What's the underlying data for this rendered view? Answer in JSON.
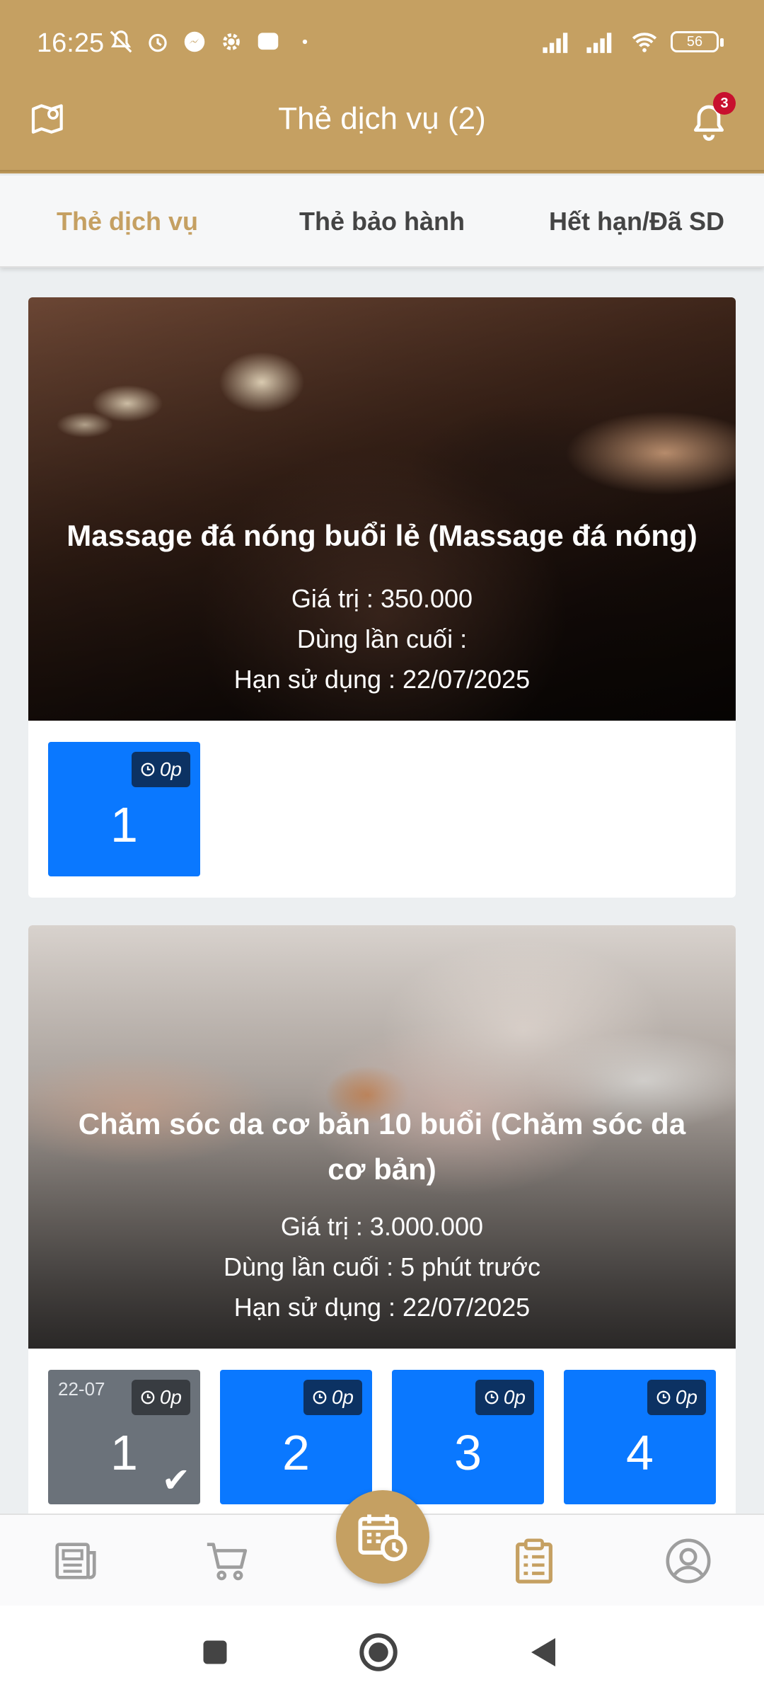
{
  "status_bar": {
    "time": "16:25",
    "battery": "56"
  },
  "header": {
    "title": "Thẻ dịch vụ (2)",
    "notification_count": "3",
    "map_icon": "map-pin-icon",
    "bell_icon": "bell-icon"
  },
  "tabs": [
    {
      "label": "Thẻ dịch vụ",
      "active": true
    },
    {
      "label": "Thẻ bảo hành",
      "active": false
    },
    {
      "label": "Hết hạn/Đã SD",
      "active": false
    }
  ],
  "cards": [
    {
      "name": "Massage đá nóng buổi lẻ (Massage đá nóng)",
      "value": "Giá trị : 350.000",
      "last_used": "Dùng lần cuối :",
      "expiry": "Hạn sử dụng : 22/07/2025",
      "sessions": [
        {
          "number": "1",
          "timer": "0p",
          "used": false
        }
      ]
    },
    {
      "name": "Chăm sóc da cơ bản 10 buổi (Chăm sóc da cơ bản)",
      "value": "Giá trị : 3.000.000",
      "last_used": "Dùng lần cuối : 5 phút trước",
      "expiry": "Hạn sử dụng : 22/07/2025",
      "sessions": [
        {
          "number": "1",
          "timer": "0p",
          "used": true,
          "date": "22-07"
        },
        {
          "number": "2",
          "timer": "0p",
          "used": false
        },
        {
          "number": "3",
          "timer": "0p",
          "used": false
        },
        {
          "number": "4",
          "timer": "0p",
          "used": false
        }
      ]
    }
  ],
  "colors": {
    "brand": "#c5a062",
    "session_blue": "#0a78ff",
    "session_used": "#6b727a",
    "badge_red": "#c8102e"
  },
  "bottom_nav": {
    "items": [
      "news-icon",
      "cart-icon",
      "calendar-clock-icon",
      "clipboard-list-icon",
      "user-circle-icon"
    ],
    "active": "clipboard-list-icon"
  }
}
